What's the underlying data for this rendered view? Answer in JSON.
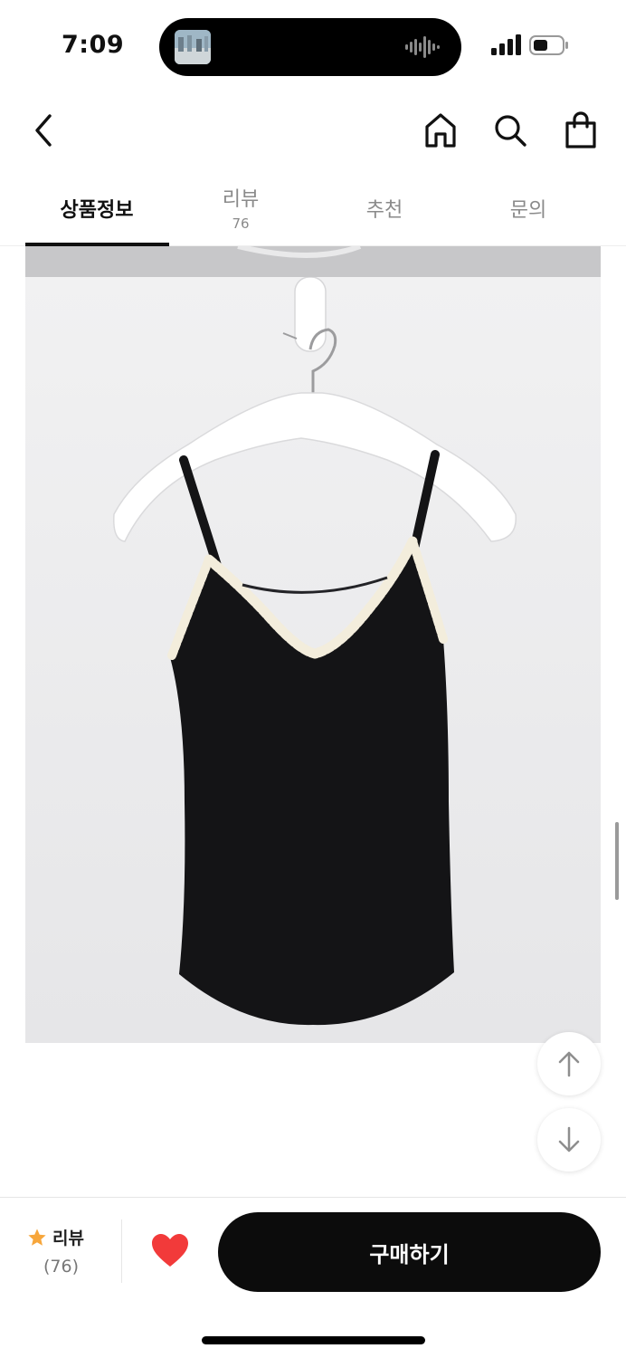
{
  "status_bar": {
    "time": "7:09",
    "icons": [
      "signal-icon",
      "battery-icon"
    ]
  },
  "nav": {
    "icons": [
      "back-chevron-icon",
      "home-icon",
      "search-icon",
      "shopping-bag-icon"
    ]
  },
  "tabs": [
    {
      "label": "상품정보",
      "count": "",
      "active": true
    },
    {
      "label": "리뷰",
      "count": "76",
      "active": false
    },
    {
      "label": "추천",
      "count": "",
      "active": false
    },
    {
      "label": "문의",
      "count": "",
      "active": false
    }
  ],
  "product_image": {
    "subject": "black camisole with cream lace trim on white hanger"
  },
  "floating_buttons": {
    "icons": [
      "arrow-up-icon",
      "arrow-down-icon"
    ]
  },
  "bottom_bar": {
    "review_label": "리뷰",
    "review_count": "(76)",
    "buy_label": "구매하기",
    "heart_color": "#f23a3a",
    "star_color": "#f7a63b"
  }
}
